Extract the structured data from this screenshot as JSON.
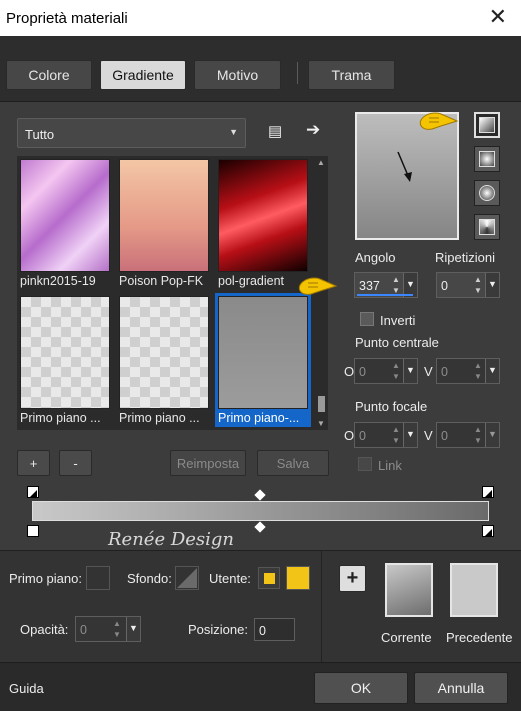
{
  "window": {
    "title": "Proprietà materiali",
    "close_icon": "close-icon"
  },
  "tabs": [
    {
      "label": "Colore",
      "active": false
    },
    {
      "label": "Gradiente",
      "active": true
    },
    {
      "label": "Motivo",
      "active": false
    },
    {
      "label": "Trama",
      "active": false
    }
  ],
  "category": {
    "selected": "Tutto"
  },
  "gradients": [
    {
      "name": "pinkn2015-19",
      "selected": false
    },
    {
      "name": "Poison Pop-FK",
      "selected": false
    },
    {
      "name": "pol-gradient",
      "selected": false
    },
    {
      "name": "Primo piano ...",
      "selected": false
    },
    {
      "name": "Primo piano ...",
      "selected": false
    },
    {
      "name": "Primo piano-...",
      "selected": true
    }
  ],
  "list_buttons": {
    "add": "+",
    "remove": "-",
    "reset": "Reimposta",
    "save": "Salva"
  },
  "angle": {
    "label": "Angolo",
    "value": "337"
  },
  "repeats": {
    "label": "Ripetizioni",
    "value": "0"
  },
  "invert": {
    "label": "Inverti",
    "checked": false
  },
  "center_point": {
    "label": "Punto centrale",
    "o_label": "O",
    "o_value": "0",
    "v_label": "V",
    "v_value": "0"
  },
  "focal_point": {
    "label": "Punto focale",
    "o_label": "O",
    "o_value": "0",
    "v_label": "V",
    "v_value": "0",
    "link_label": "Link"
  },
  "watermark": "Renée Design",
  "materials": {
    "foreground_label": "Primo piano:",
    "background_label": "Sfondo:",
    "user_label": "Utente:",
    "user_color": "#f2c417",
    "opacity_label": "Opacità:",
    "opacity_value": "0",
    "position_label": "Posizione:",
    "position_value": "0",
    "current_label": "Corrente",
    "previous_label": "Precedente"
  },
  "footer": {
    "help": "Guida",
    "ok": "OK",
    "cancel": "Annulla"
  },
  "colors": {
    "accent": "#1467c9",
    "highlight": "#f2c417"
  }
}
